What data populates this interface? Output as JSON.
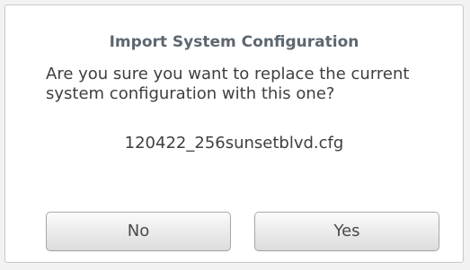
{
  "dialog": {
    "title": "Import System Configuration",
    "message": "Are you sure you want to replace the current system configuration with this one?",
    "filename": "120422_256sunsetblvd.cfg",
    "buttons": {
      "no_label": "No",
      "yes_label": "Yes"
    }
  }
}
